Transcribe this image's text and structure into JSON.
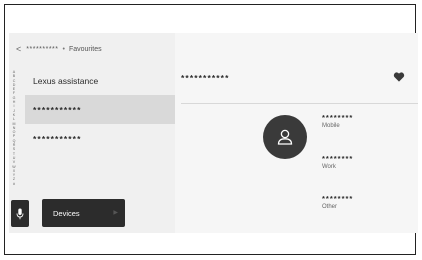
{
  "breadcrumb": {
    "back_glyph": "<",
    "masked_title": "**********",
    "separator": "•",
    "current": "Favourites"
  },
  "alphabet": [
    "A",
    "B",
    "C",
    "D",
    "E",
    "F",
    "G",
    "H",
    "I",
    "J",
    "K",
    "L",
    "M",
    "N",
    "O",
    "P",
    "Q",
    "R",
    "S",
    "T",
    "U",
    "V",
    "W",
    "X",
    "Y",
    "Z",
    "#"
  ],
  "list": {
    "items": [
      {
        "label": "Lexus assistance"
      },
      {
        "label": "***********"
      },
      {
        "label": "***********"
      }
    ]
  },
  "bottom_bar": {
    "mic_icon": "microphone-icon",
    "devices_label": "Devices"
  },
  "contact": {
    "name": "***********",
    "avatar_icon": "person-icon",
    "favourite_icon": "heart-icon",
    "numbers": [
      {
        "value": "********",
        "label": "Mobile"
      },
      {
        "value": "********",
        "label": "Work"
      },
      {
        "value": "********",
        "label": "Other"
      }
    ]
  }
}
